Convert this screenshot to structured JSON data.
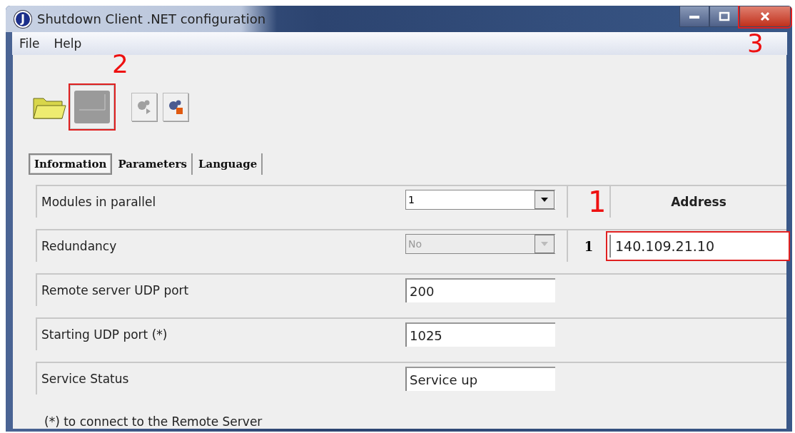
{
  "window": {
    "icon_letter": "J",
    "title": "Shutdown Client .NET configuration",
    "controls": [
      {
        "kind": "minimize",
        "highlighted": false
      },
      {
        "kind": "maximize",
        "highlighted": false
      },
      {
        "kind": "close",
        "highlighted": true,
        "marker": "3"
      }
    ]
  },
  "menu": [
    "File",
    "Help"
  ],
  "toolbar": [
    {
      "kind": "folder",
      "disabled": false,
      "highlighted": false
    },
    {
      "kind": "blank",
      "disabled": true,
      "highlighted": true,
      "marker": "2"
    },
    {
      "kind": "gear-play",
      "disabled": true,
      "highlighted": false
    },
    {
      "kind": "gear-stop",
      "disabled": false,
      "highlighted": false
    }
  ],
  "tabs": [
    {
      "label": "Information",
      "selected": true
    },
    {
      "label": "Parameters",
      "selected": false
    },
    {
      "label": "Language",
      "selected": false
    }
  ],
  "fields": [
    {
      "label": "Modules in parallel",
      "kind": "select",
      "value": "1",
      "disabled": false
    },
    {
      "label": "Redundancy",
      "kind": "select",
      "value": "No",
      "disabled": true
    },
    {
      "label": "Remote server UDP port",
      "kind": "text",
      "value": "200"
    },
    {
      "label": "Starting UDP port (*)",
      "kind": "text",
      "value": "1025"
    },
    {
      "label": "Service Status",
      "kind": "text",
      "value": "Service up"
    }
  ],
  "address_table": {
    "header": "Address",
    "header_marker": "1",
    "rows": [
      {
        "index": "1",
        "address": "140.109.21.10",
        "highlighted": true
      }
    ]
  },
  "footnote": "(*) to connect to the Remote Server"
}
